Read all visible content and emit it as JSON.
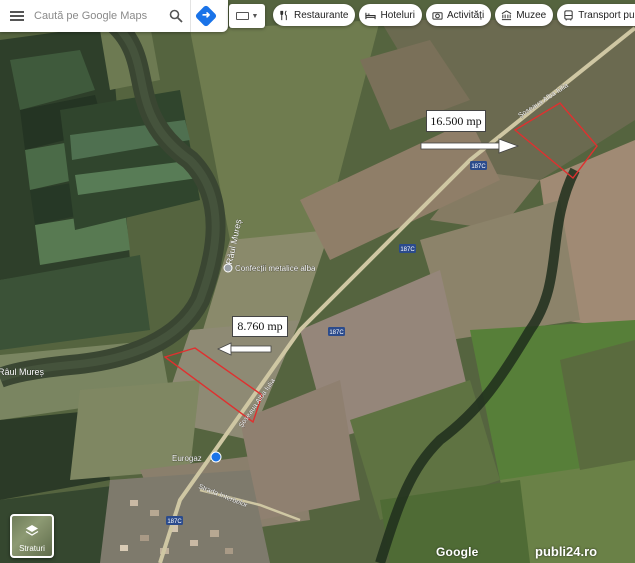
{
  "search": {
    "placeholder": "Caută pe Google Maps"
  },
  "chips": [
    {
      "label": "Restaurante",
      "icon": "fork-knife-icon"
    },
    {
      "label": "Hoteluri",
      "icon": "bed-icon"
    },
    {
      "label": "Activități",
      "icon": "camera-icon"
    },
    {
      "label": "Muzee",
      "icon": "museum-icon"
    },
    {
      "label": "Transport public",
      "icon": "bus-icon"
    }
  ],
  "map_labels": {
    "river_upper": "Râul Mureș",
    "river_lower": "Râul Mureș",
    "road_north": "Șoseaua Alba Iulia",
    "road_south": "Șoseaua Alba Iulia",
    "street_bottom": "Strada Interbelor",
    "poi_confectii": "Confecții metalice alba",
    "poi_eurogaz": "Eurogaz",
    "road_shield_1": "187C",
    "road_shield_2": "187C",
    "road_shield_3": "187C",
    "road_shield_4": "187C"
  },
  "parcels": [
    {
      "area_label": "16.500 mp"
    },
    {
      "area_label": "8.760 mp"
    }
  ],
  "layers": {
    "label": "Straturi"
  },
  "footer": {
    "google_logo": "Google",
    "watermark": "publi24.ro"
  },
  "colors": {
    "parcel_outline": "#e0302f",
    "road": "#d8cfa8",
    "river": "#3d4a36",
    "poi_blue": "#1a73e8"
  }
}
